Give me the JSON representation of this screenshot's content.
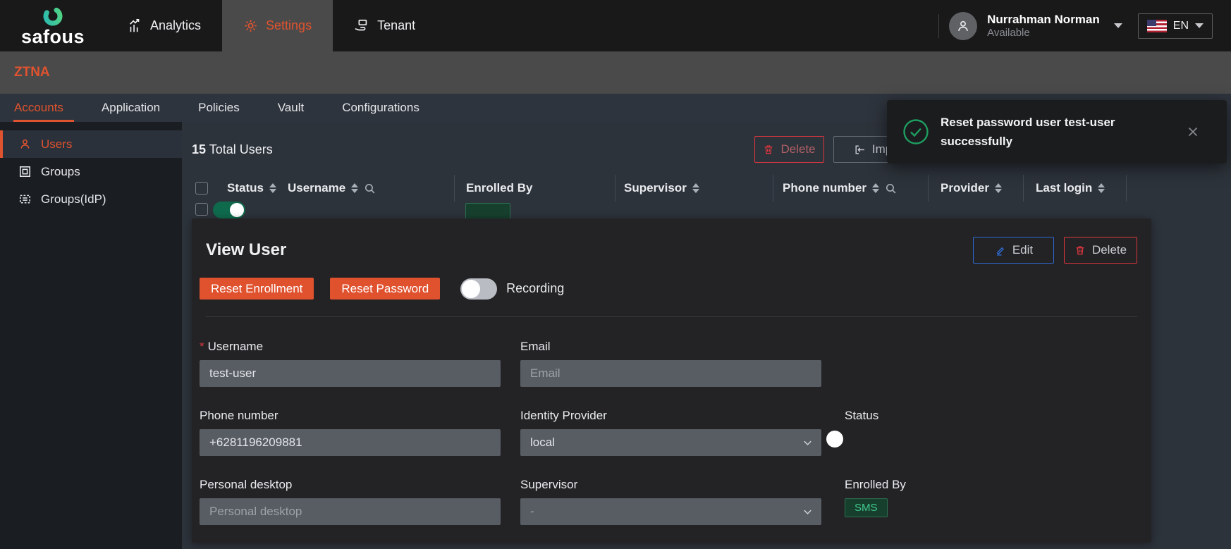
{
  "topbar": {
    "logo_text": "safous",
    "nav_analytics": "Analytics",
    "nav_settings": "Settings",
    "nav_tenant": "Tenant",
    "user_name": "Nurrahman Norman",
    "user_status": "Available",
    "language": "EN"
  },
  "module_label": "ZTNA",
  "tabs": [
    {
      "label": "Accounts",
      "active": true
    },
    {
      "label": "Application",
      "active": false
    },
    {
      "label": "Policies",
      "active": false
    },
    {
      "label": "Vault",
      "active": false
    },
    {
      "label": "Configurations",
      "active": false
    }
  ],
  "sidebar": {
    "items": [
      {
        "label": "Users",
        "active": true
      },
      {
        "label": "Groups",
        "active": false
      },
      {
        "label": "Groups(IdP)",
        "active": false
      }
    ]
  },
  "toolbar": {
    "total_count": "15",
    "total_label": "Total Users",
    "delete_label": "Delete",
    "import_label": "Import"
  },
  "table": {
    "columns": [
      {
        "label": "Status",
        "sortable": true
      },
      {
        "label": "Username",
        "sortable": true,
        "searchable": true
      },
      {
        "label": "Enrolled By"
      },
      {
        "label": "Supervisor",
        "sortable": true
      },
      {
        "label": "Phone number",
        "sortable": true,
        "searchable": true
      },
      {
        "label": "Provider",
        "sortable": true
      },
      {
        "label": "Last login",
        "sortable": true
      }
    ]
  },
  "toast": {
    "message": "Reset password user test-user successfully"
  },
  "panel": {
    "title": "View User",
    "edit_label": "Edit",
    "delete_label": "Delete",
    "reset_enrollment_label": "Reset Enrollment",
    "reset_password_label": "Reset Password",
    "recording_label": "Recording",
    "recording_on": false,
    "fields": {
      "username": {
        "label": "Username",
        "required": true,
        "value": "test-user"
      },
      "email": {
        "label": "Email",
        "placeholder": "Email",
        "value": ""
      },
      "phone": {
        "label": "Phone number",
        "value": "+6281196209881"
      },
      "identity_provider": {
        "label": "Identity Provider",
        "value": "local"
      },
      "status": {
        "label": "Status",
        "on": true
      },
      "personal_desktop": {
        "label": "Personal desktop",
        "placeholder": "Personal desktop",
        "value": ""
      },
      "supervisor": {
        "label": "Supervisor",
        "value": "-"
      },
      "enrolled_by": {
        "label": "Enrolled By",
        "badge": "SMS"
      }
    }
  },
  "colors": {
    "accent_orange": "#e0532f",
    "danger_red": "#d9363e",
    "primary_blue": "#2e69d1",
    "success_green": "#1e9e60",
    "toggle_green": "#0f6a4c"
  }
}
